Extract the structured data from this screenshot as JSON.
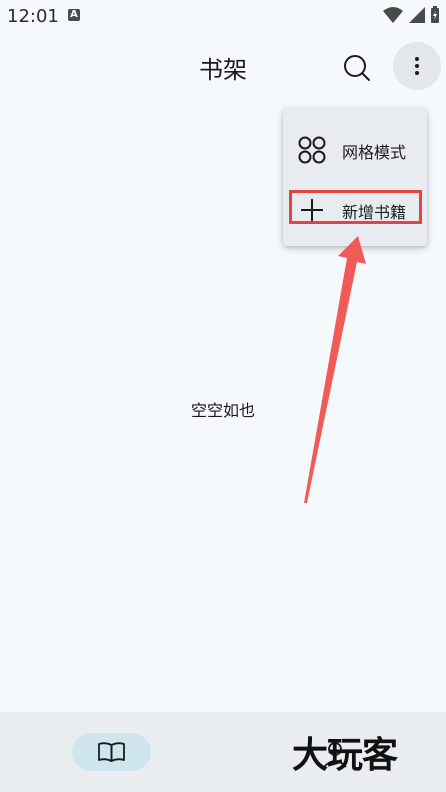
{
  "status_bar": {
    "time": "12:01",
    "notification_icon": "A"
  },
  "app_bar": {
    "title": "书架"
  },
  "menu": {
    "items": [
      {
        "label": "网格模式",
        "icon": "grid-four-circles-icon"
      },
      {
        "label": "新增书籍",
        "icon": "plus-icon"
      }
    ]
  },
  "main": {
    "empty_text": "空空如也"
  },
  "bottom_nav": {
    "items": [
      {
        "icon": "book-open-icon",
        "active": true
      },
      {
        "icon": "person-icon",
        "active": false
      }
    ]
  },
  "watermark": "大玩客",
  "colors": {
    "background": "#f5f9fc",
    "menu_bg": "#e8ebef",
    "highlight": "#e8423e",
    "nav_active": "#cfe6ee"
  }
}
